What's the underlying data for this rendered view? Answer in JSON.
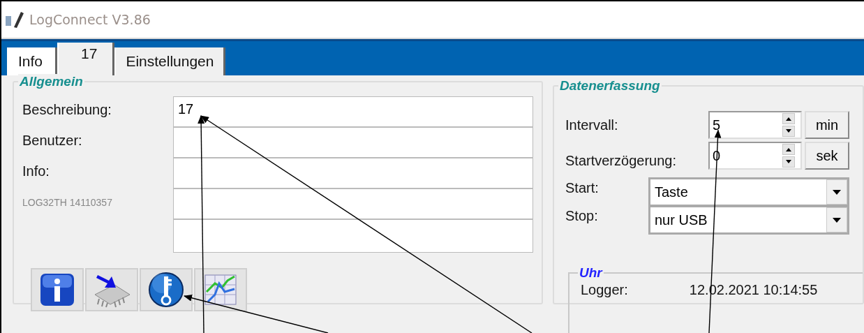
{
  "window": {
    "title": "LogConnect V3.86"
  },
  "tabs": [
    {
      "label": "Info",
      "selected": false
    },
    {
      "label": "17",
      "selected": true
    },
    {
      "label": "Einstellungen",
      "selected": false
    }
  ],
  "general": {
    "title": "Allgemein",
    "rows": [
      {
        "kind": "labeled",
        "label": "Beschreibung:",
        "value": "17"
      },
      {
        "kind": "labeled",
        "label": "Benutzer:"
      },
      {
        "kind": "labeled",
        "label": "Info:"
      },
      {
        "kind": "note",
        "label": "LOG32TH 14110357"
      },
      {
        "kind": "blank"
      }
    ],
    "icon_buttons": [
      {
        "kind": "info"
      },
      {
        "kind": "chip"
      },
      {
        "kind": "key"
      },
      {
        "kind": "chart"
      }
    ]
  },
  "acquisition": {
    "title": "Datenerfassung",
    "spinners": [
      {
        "label": "Intervall:",
        "value": "5",
        "unit": "min"
      },
      {
        "label": "Startverzögerung:",
        "value": "0",
        "unit": "sek"
      }
    ],
    "dropdowns": [
      {
        "label": "Start:",
        "value": "Taste"
      },
      {
        "label": "Stop:",
        "value": "nur USB"
      }
    ],
    "clock": {
      "title": "Uhr",
      "label": "Logger:",
      "value": "12.02.2021 10:14:55"
    }
  },
  "annotations": [
    {
      "kind": "arrow"
    },
    {
      "kind": "arrow"
    },
    {
      "kind": "arrow"
    },
    {
      "kind": "arrow"
    }
  ]
}
